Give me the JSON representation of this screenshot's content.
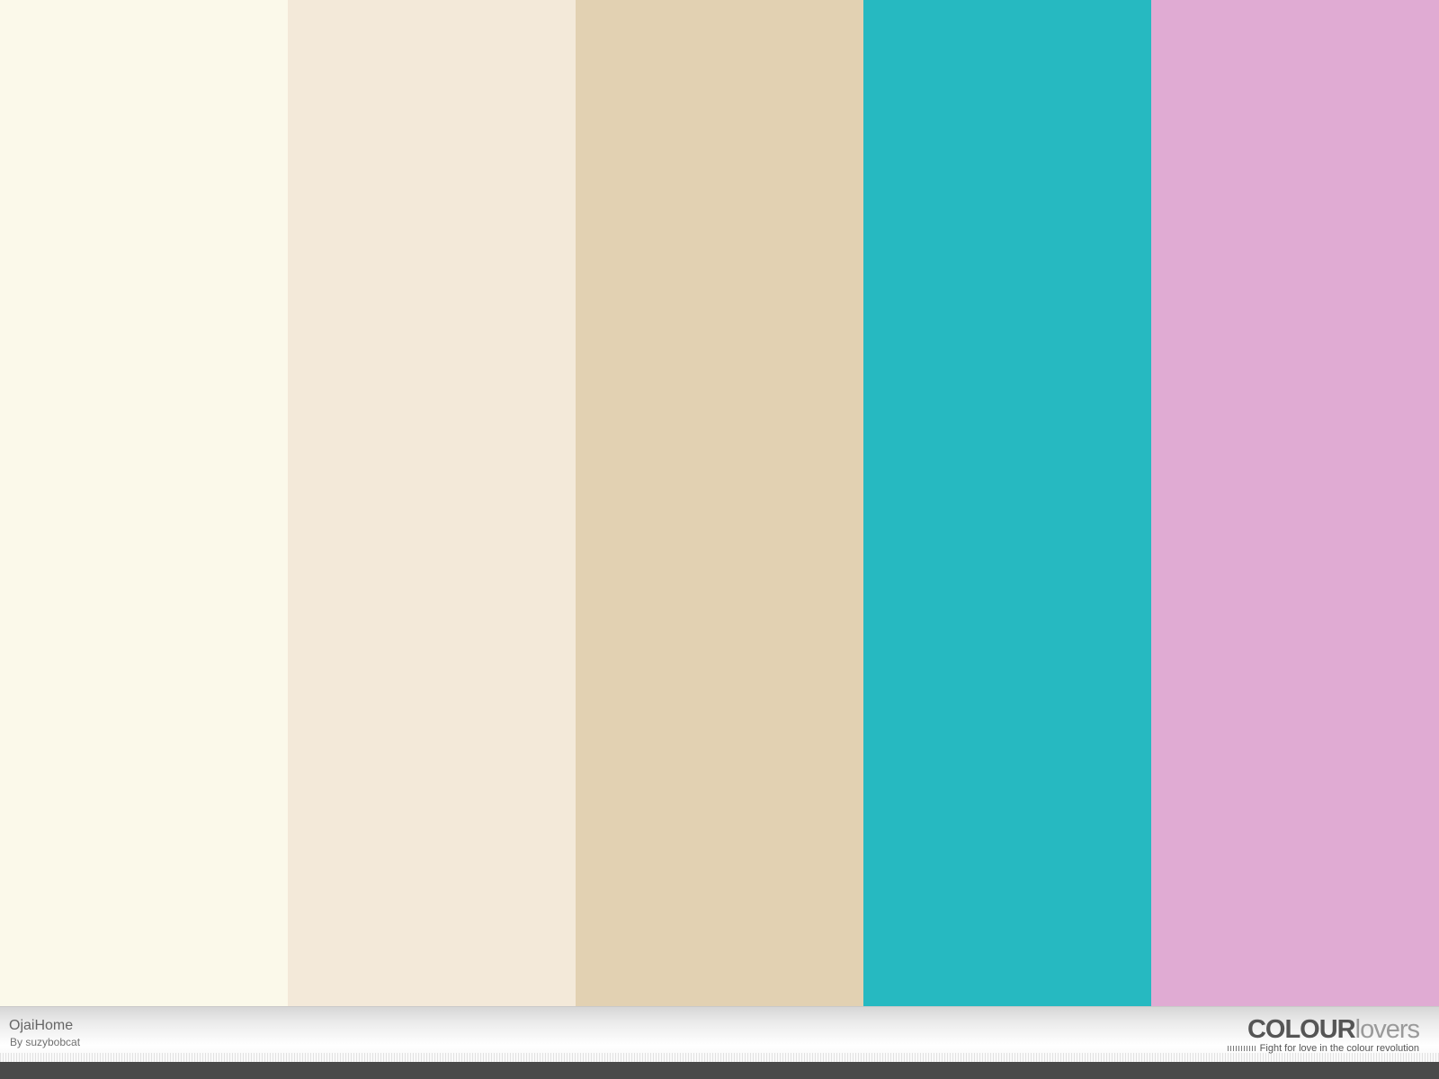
{
  "palette": {
    "title": "OjaiHome",
    "author": "By suzybobcat",
    "colors": [
      "#FBF9EA",
      "#F3E9D9",
      "#E2D1B2",
      "#26B9C1",
      "#E0ABD3"
    ]
  },
  "brand": {
    "name_bold": "COLOUR",
    "name_light": "lovers",
    "tagline": "Fight for love in the colour revolution"
  }
}
